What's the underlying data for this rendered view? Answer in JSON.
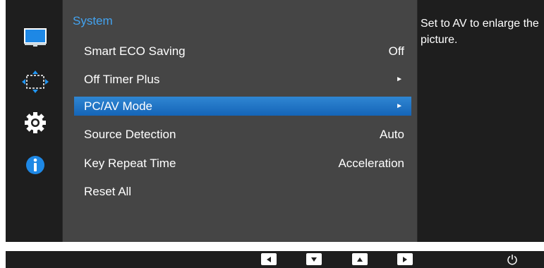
{
  "menu": {
    "title": "System",
    "items": [
      {
        "label": "Smart ECO Saving",
        "value": "Off"
      },
      {
        "label": "Off Timer Plus",
        "value": "►"
      },
      {
        "label": "PC/AV Mode",
        "value": "►"
      },
      {
        "label": "Source Detection",
        "value": "Auto"
      },
      {
        "label": "Key Repeat Time",
        "value": "Acceleration"
      },
      {
        "label": "Reset All",
        "value": ""
      }
    ],
    "selected_item": "PC/AV Mode"
  },
  "help_text": "Set to AV to enlarge the picture.",
  "side_icons": [
    "picture-icon",
    "onscreen-display-icon",
    "system-gear-icon",
    "information-icon"
  ],
  "bottom_buttons": [
    "left-arrow-button",
    "down-arrow-button",
    "up-arrow-button",
    "right-arrow-button",
    "power-button"
  ],
  "colors": {
    "accent": "#43a3f0",
    "selection": "#1f74c6",
    "panel": "#454545",
    "dark": "#1e1e1e"
  }
}
